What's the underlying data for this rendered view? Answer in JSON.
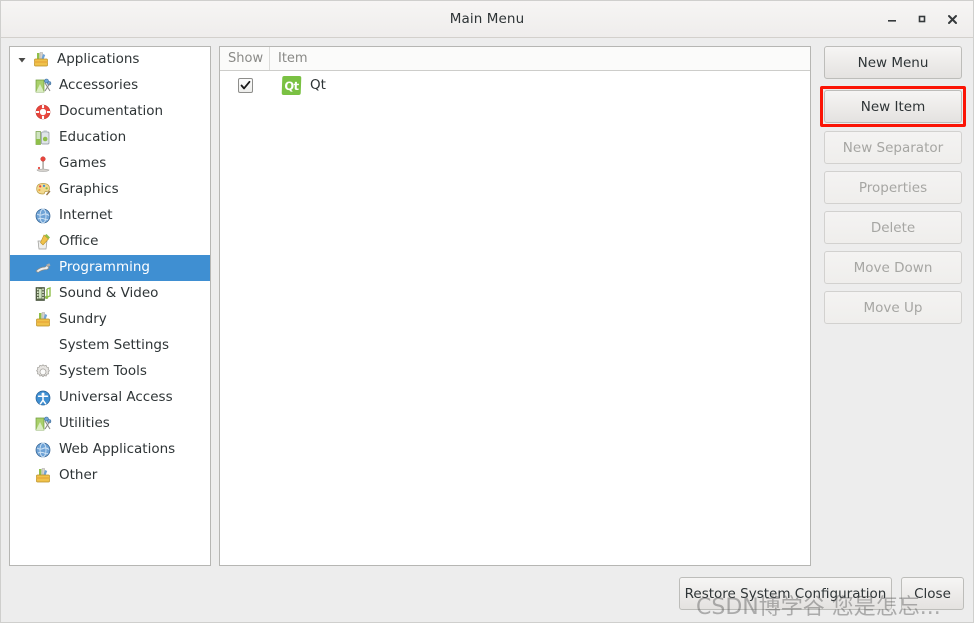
{
  "window": {
    "title": "Main Menu",
    "controls": [
      {
        "name": "minimize",
        "glyph": "minimize-icon"
      },
      {
        "name": "maximize",
        "glyph": "maximize-icon"
      },
      {
        "name": "close",
        "glyph": "close-icon"
      }
    ]
  },
  "tree": {
    "root": {
      "label": "Applications",
      "icon": "toolbox-icon",
      "expanded": true
    },
    "items": [
      {
        "label": "Accessories",
        "icon": "accessories-icon",
        "selected": false
      },
      {
        "label": "Documentation",
        "icon": "lifering-icon",
        "selected": false
      },
      {
        "label": "Education",
        "icon": "education-icon",
        "selected": false
      },
      {
        "label": "Games",
        "icon": "joystick-icon",
        "selected": false
      },
      {
        "label": "Graphics",
        "icon": "palette-icon",
        "selected": false
      },
      {
        "label": "Internet",
        "icon": "globe-icon",
        "selected": false
      },
      {
        "label": "Office",
        "icon": "office-icon",
        "selected": false
      },
      {
        "label": "Programming",
        "icon": "programming-icon",
        "selected": true
      },
      {
        "label": "Sound & Video",
        "icon": "film-icon",
        "selected": false
      },
      {
        "label": "Sundry",
        "icon": "toolbox-icon",
        "selected": false
      },
      {
        "label": "System Settings",
        "icon": "none",
        "selected": false
      },
      {
        "label": "System Tools",
        "icon": "gear-icon",
        "selected": false
      },
      {
        "label": "Universal Access",
        "icon": "accessibility-icon",
        "selected": false
      },
      {
        "label": "Utilities",
        "icon": "accessories-icon",
        "selected": false
      },
      {
        "label": "Web Applications",
        "icon": "globe-icon",
        "selected": false
      },
      {
        "label": "Other",
        "icon": "toolbox-icon",
        "selected": false
      }
    ]
  },
  "list": {
    "columns": [
      {
        "key": "show",
        "label": "Show"
      },
      {
        "key": "item",
        "label": "Item"
      }
    ],
    "rows": [
      {
        "show": true,
        "icon": "qt-icon",
        "icon_text": "Qt",
        "label": "Qt"
      }
    ]
  },
  "side_buttons": [
    {
      "label": "New Menu",
      "enabled": true,
      "highlighted": false
    },
    {
      "label": "New Item",
      "enabled": true,
      "highlighted": true
    },
    {
      "label": "New Separator",
      "enabled": false,
      "highlighted": false
    },
    {
      "label": "Properties",
      "enabled": false,
      "highlighted": false
    },
    {
      "label": "Delete",
      "enabled": false,
      "highlighted": false
    },
    {
      "label": "Move Down",
      "enabled": false,
      "highlighted": false
    },
    {
      "label": "Move Up",
      "enabled": false,
      "highlighted": false
    }
  ],
  "footer": {
    "restore_label": "Restore System Configuration",
    "close_label": "Close"
  },
  "watermark": {
    "text": "CSDN博学谷 您是怎忘..."
  },
  "colors": {
    "selection": "#3f8fd2",
    "highlight_box": "#fb1405",
    "qt_green": "#7ac143",
    "window_bg": "#ededed"
  }
}
